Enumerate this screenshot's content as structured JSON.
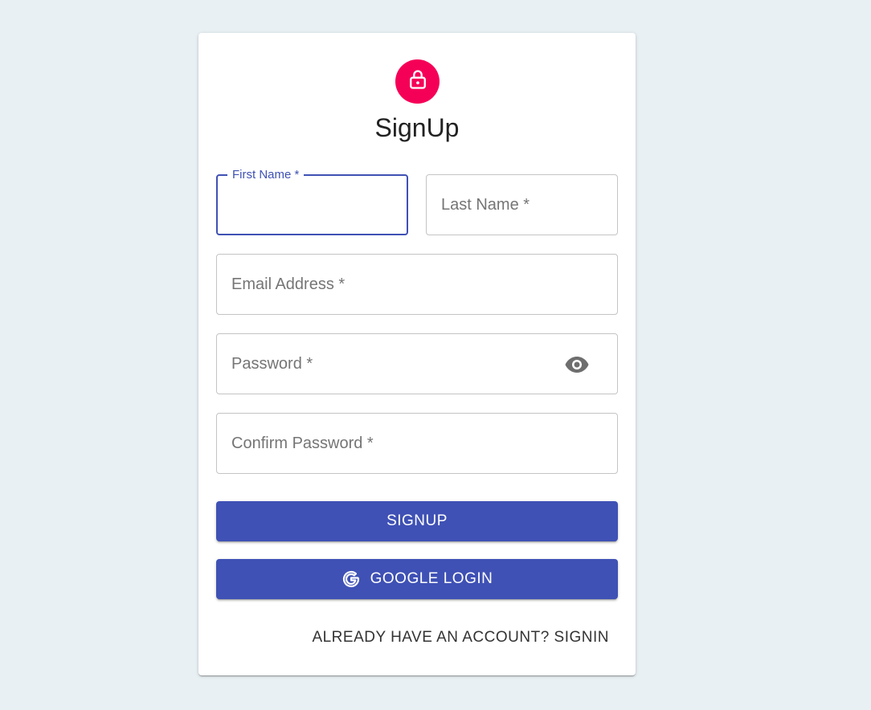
{
  "form": {
    "title": "SignUp",
    "fields": {
      "first_name": {
        "label": "First Name *",
        "value": ""
      },
      "last_name": {
        "label": "Last Name *",
        "value": ""
      },
      "email": {
        "label": "Email Address *",
        "value": ""
      },
      "password": {
        "label": "Password *",
        "value": ""
      },
      "confirm_password": {
        "label": "Confirm Password *",
        "value": ""
      }
    },
    "signup_button": "SIGNUP",
    "google_button": "GOOGLE LOGIN",
    "signin_link": "ALREADY HAVE AN ACCOUNT? SIGNIN"
  },
  "icons": {
    "avatar": "lock-icon",
    "password_toggle": "eye-icon",
    "google": "google-icon"
  },
  "colors": {
    "background": "#e8f0f4",
    "card": "#ffffff",
    "primary": "#3f51b5",
    "avatar": "#f50057",
    "placeholder": "#757575"
  }
}
